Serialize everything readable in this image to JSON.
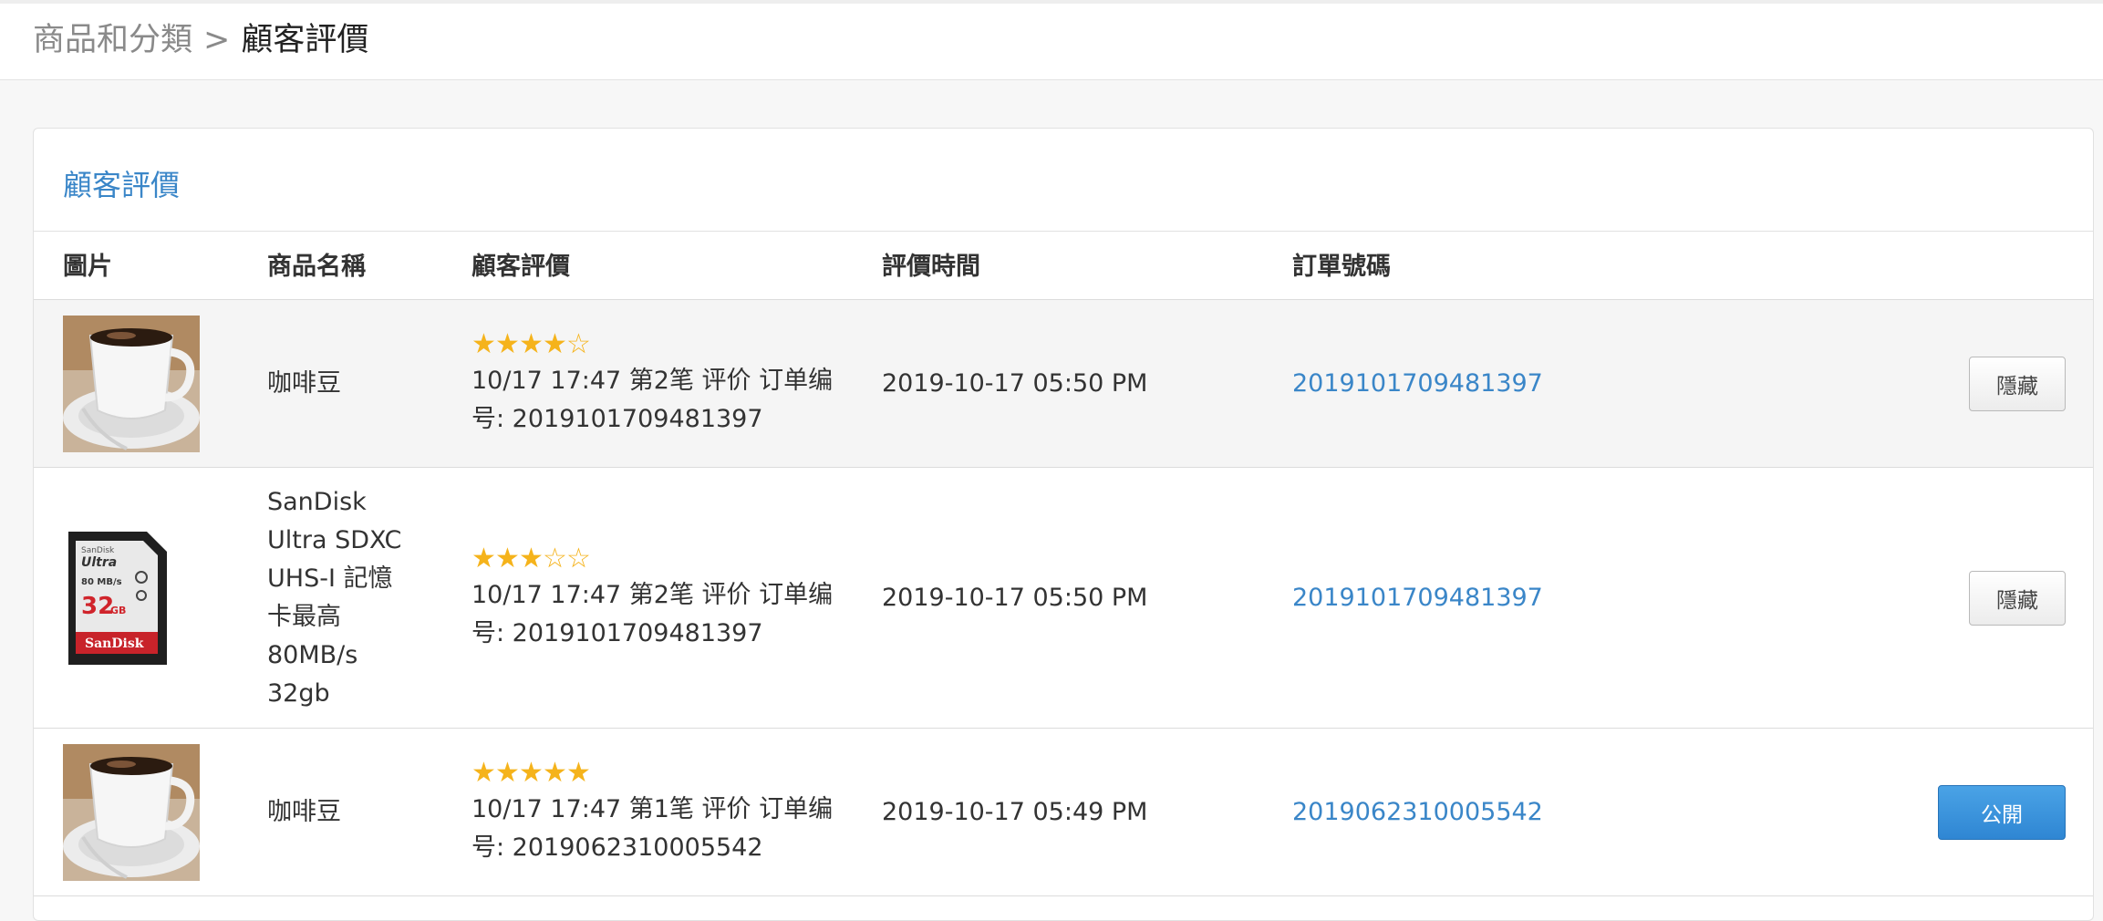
{
  "breadcrumb": {
    "parent": "商品和分類",
    "separator": ">",
    "current": "顧客評價"
  },
  "panel": {
    "title": "顧客評價"
  },
  "table": {
    "headers": {
      "image": "圖片",
      "product_name": "商品名稱",
      "review": "顧客評價",
      "review_time": "評價時間",
      "order_number": "訂單號碼"
    },
    "rows": [
      {
        "image_icon": "coffee-cup-image",
        "product_name": "咖啡豆",
        "rating": 4,
        "rating_max": 5,
        "review_text": "10/17 17:47 第2笔 评价 订单编号: 2019101709481397",
        "review_time": "2019-10-17 05:50 PM",
        "order_number": "2019101709481397",
        "action_label": "隱藏"
      },
      {
        "image_icon": "sd-card-image",
        "product_name": "SanDisk\nUltra SDXC\nUHS-I 記憶\n卡最高\n80MB/s\n32gb",
        "rating": 3,
        "rating_max": 5,
        "review_text": "10/17 17:47 第2笔 评价 订单编号: 2019101709481397",
        "review_time": "2019-10-17 05:50 PM",
        "order_number": "2019101709481397",
        "action_label": "隱藏"
      },
      {
        "image_icon": "coffee-cup-image",
        "product_name": "咖啡豆",
        "rating": 5,
        "rating_max": 5,
        "review_text": "10/17 17:47 第1笔 评价 订单编号: 2019062310005542",
        "review_time": "2019-10-17 05:49 PM",
        "order_number": "2019062310005542",
        "action_label": "公開"
      }
    ]
  },
  "sd_card": {
    "brand_top": "SanDisk",
    "model": "Ultra",
    "speed": "80 MB/s",
    "capacity_num": "32",
    "capacity_unit": "GB",
    "brand_bottom": "SanDisk"
  },
  "colors": {
    "accent": "#3a86c8",
    "star": "#f5b31b",
    "primary_button": "#3a8fd9"
  }
}
